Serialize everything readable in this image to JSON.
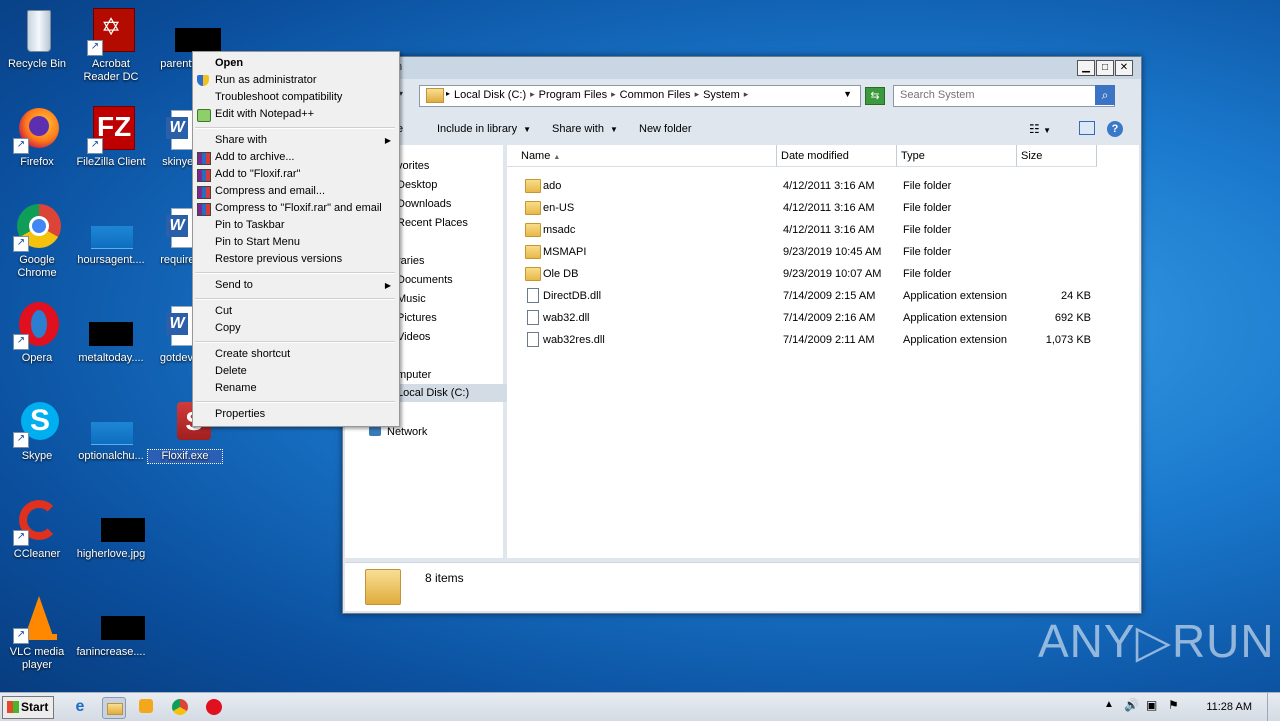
{
  "desktop": {
    "icons": [
      {
        "label": "Recycle Bin"
      },
      {
        "label": "Acrobat Reader DC"
      },
      {
        "label": "parentfu..."
      },
      {
        "label": "Firefox"
      },
      {
        "label": "FileZilla Client"
      },
      {
        "label": "skinyes..."
      },
      {
        "label": "Google Chrome"
      },
      {
        "label": "hoursagent...."
      },
      {
        "label": "requireh..."
      },
      {
        "label": "Opera"
      },
      {
        "label": "metaltoday...."
      },
      {
        "label": "gotdevic..."
      },
      {
        "label": "Skype"
      },
      {
        "label": "optionalchu..."
      },
      {
        "label": "Floxif.exe"
      },
      {
        "label": "CCleaner"
      },
      {
        "label": "higherlove.jpg"
      },
      {
        "label": "VLC media player"
      },
      {
        "label": "fanincrease...."
      }
    ]
  },
  "explorer": {
    "title_fragment": "m",
    "breadcrumb": [
      "Local Disk (C:)",
      "Program Files",
      "Common Files",
      "System"
    ],
    "search_placeholder": "Search System",
    "toolbar": {
      "organize_fragment": "e",
      "include_library": "Include in library",
      "share_with": "Share with",
      "new_folder": "New folder"
    },
    "nav": [
      "vorites",
      "Desktop",
      "Downloads",
      "Recent Places",
      "raries",
      "Documents",
      "Music",
      "Pictures",
      "Videos",
      "mputer",
      "Local Disk (C:)",
      "Network"
    ],
    "columns": {
      "name": "Name",
      "date": "Date modified",
      "type": "Type",
      "size": "Size"
    },
    "files": [
      {
        "name": "ado",
        "date": "4/12/2011 3:16 AM",
        "type": "File folder",
        "size": "",
        "kind": "folder"
      },
      {
        "name": "en-US",
        "date": "4/12/2011 3:16 AM",
        "type": "File folder",
        "size": "",
        "kind": "folder"
      },
      {
        "name": "msadc",
        "date": "4/12/2011 3:16 AM",
        "type": "File folder",
        "size": "",
        "kind": "folder"
      },
      {
        "name": "MSMAPI",
        "date": "9/23/2019 10:45 AM",
        "type": "File folder",
        "size": "",
        "kind": "folder"
      },
      {
        "name": "Ole DB",
        "date": "9/23/2019 10:07 AM",
        "type": "File folder",
        "size": "",
        "kind": "folder"
      },
      {
        "name": "DirectDB.dll",
        "date": "7/14/2009 2:15 AM",
        "type": "Application extension",
        "size": "24 KB",
        "kind": "dll"
      },
      {
        "name": "wab32.dll",
        "date": "7/14/2009 2:16 AM",
        "type": "Application extension",
        "size": "692 KB",
        "kind": "dll"
      },
      {
        "name": "wab32res.dll",
        "date": "7/14/2009 2:11 AM",
        "type": "Application extension",
        "size": "1,073 KB",
        "kind": "dll"
      }
    ],
    "status": "8 items"
  },
  "context_menu": {
    "open": "Open",
    "run_as_admin": "Run as administrator",
    "troubleshoot": "Troubleshoot compatibility",
    "edit_npp": "Edit with Notepad++",
    "share_with": "Share with",
    "add_archive": "Add to archive...",
    "add_rar": "Add to \"Floxif.rar\"",
    "compress_email": "Compress and email...",
    "compress_rar_email": "Compress to \"Floxif.rar\" and email",
    "pin_taskbar": "Pin to Taskbar",
    "pin_start": "Pin to Start Menu",
    "restore": "Restore previous versions",
    "send_to": "Send to",
    "cut": "Cut",
    "copy": "Copy",
    "create_shortcut": "Create shortcut",
    "delete": "Delete",
    "rename": "Rename",
    "properties": "Properties"
  },
  "taskbar": {
    "start_label": "Start",
    "clock": "11:28 AM"
  },
  "watermark": "ANY▷RUN",
  "colors": {
    "desktop_blue": "#1a78cc",
    "selection": "#2a5fb5"
  }
}
